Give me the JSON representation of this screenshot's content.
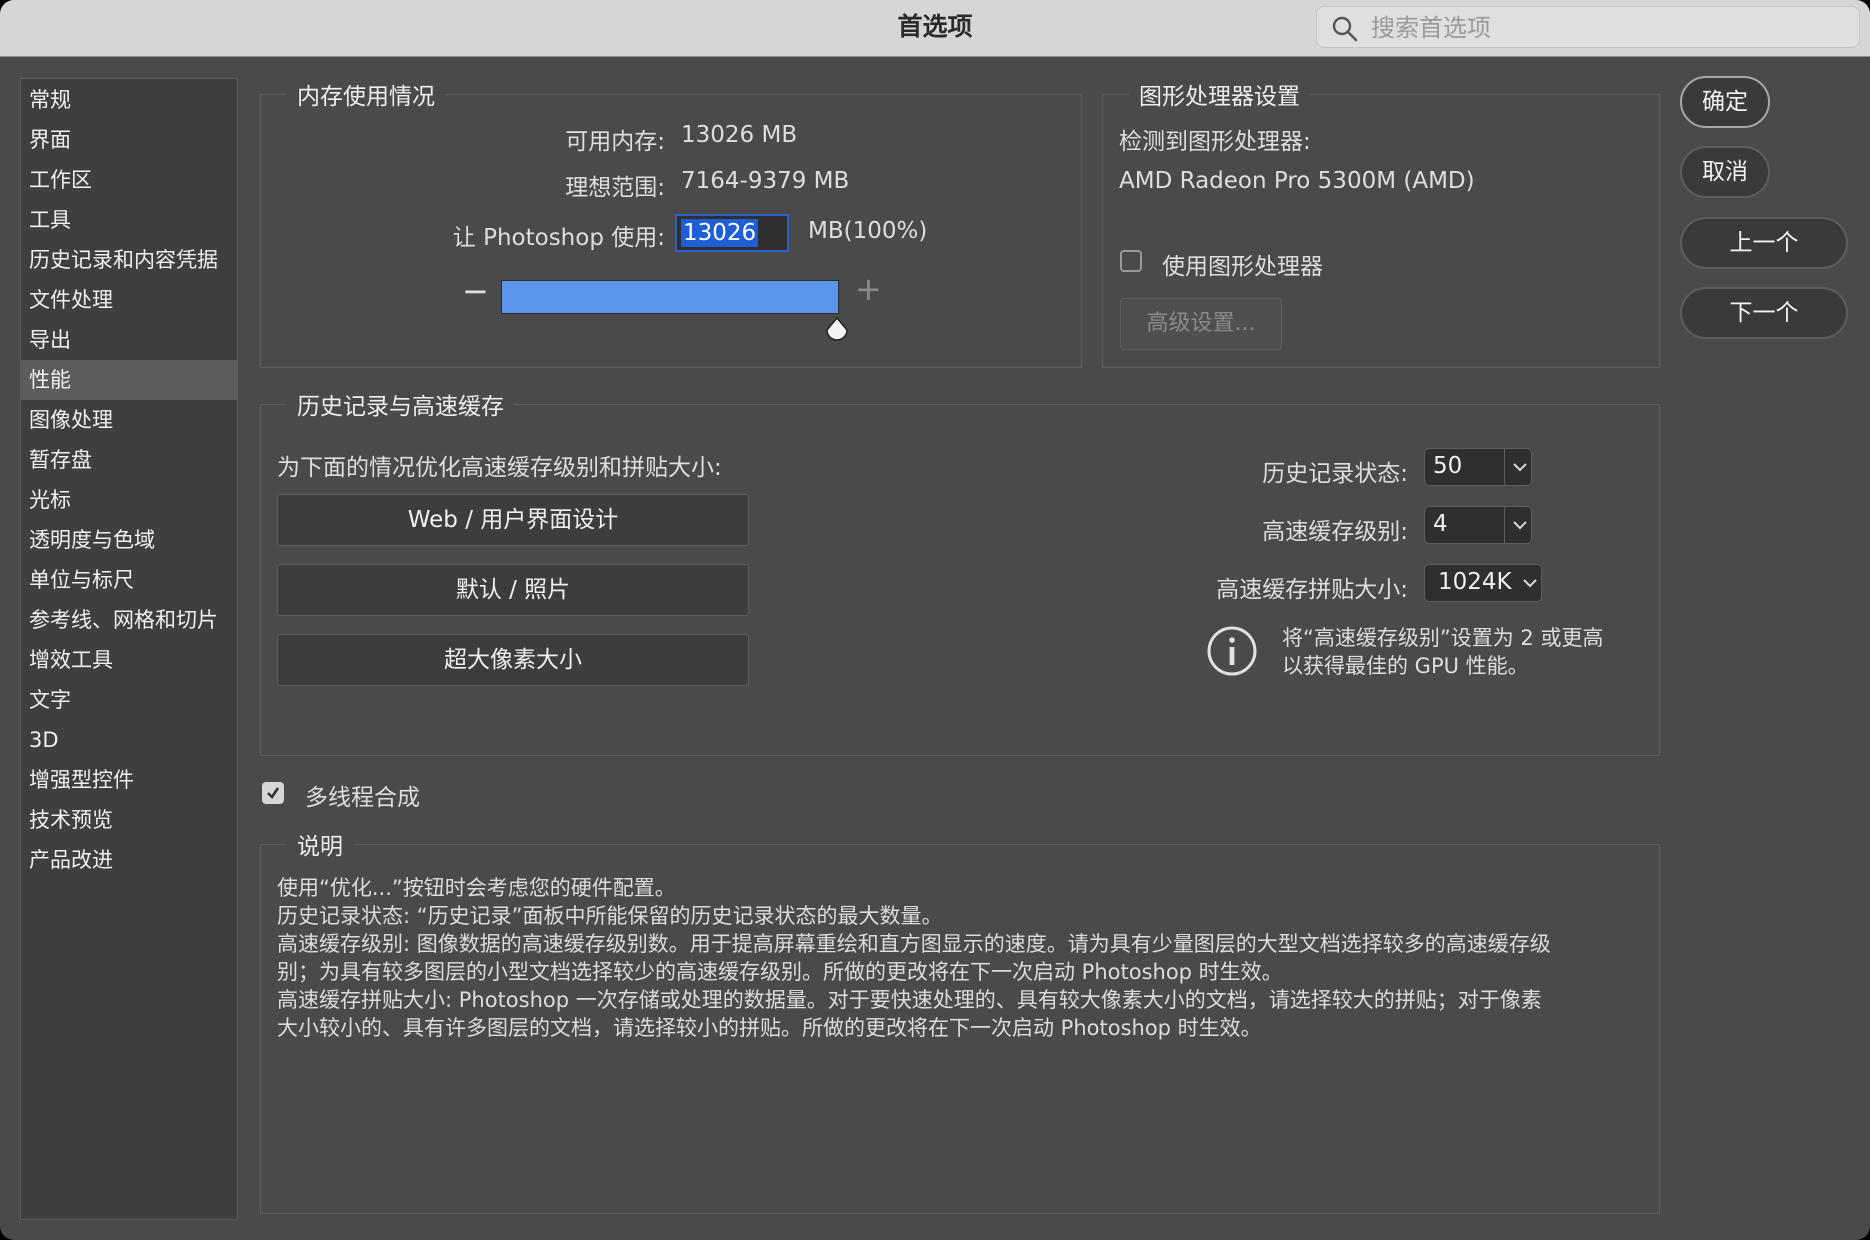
{
  "window": {
    "title": "首选项"
  },
  "search": {
    "placeholder": "搜索首选项"
  },
  "sidebar": {
    "items": [
      "常规",
      "界面",
      "工作区",
      "工具",
      "历史记录和内容凭据",
      "文件处理",
      "导出",
      "性能",
      "图像处理",
      "暂存盘",
      "光标",
      "透明度与色域",
      "单位与标尺",
      "参考线、网格和切片",
      "增效工具",
      "文字",
      "3D",
      "增强型控件",
      "技术预览",
      "产品改进"
    ],
    "active_index": 7
  },
  "memory": {
    "legend": "内存使用情况",
    "available_label": "可用内存:",
    "available_value": "13026 MB",
    "ideal_label": "理想范围:",
    "ideal_value": "7164-9379 MB",
    "use_label": "让 Photoshop 使用:",
    "use_value": "13026",
    "use_unit": "MB(100%)",
    "slider_level": 1.0,
    "minus": "−",
    "plus": "+"
  },
  "gpu": {
    "legend": "图形处理器设置",
    "detected_label": "检测到图形处理器:",
    "gpu_name": "AMD Radeon Pro 5300M (AMD)",
    "use_gpu_label": "使用图形处理器",
    "use_gpu_checked": false,
    "advanced_button": "高级设置..."
  },
  "buttons": {
    "ok": "确定",
    "cancel": "取消",
    "prev": "上一个",
    "next": "下一个"
  },
  "history": {
    "legend": "历史记录与高速缓存",
    "optimize_label": "为下面的情况优化高速缓存级别和拼贴大小:",
    "opt_buttons": [
      "Web / 用户界面设计",
      "默认 / 照片",
      "超大像素大小"
    ],
    "states_label": "历史记录状态:",
    "states_value": "50",
    "cache_levels_label": "高速缓存级别:",
    "cache_levels_value": "4",
    "tile_size_label": "高速缓存拼贴大小:",
    "tile_size_value": "1024K",
    "info_line1": "将“高速缓存级别”设置为 2 或更高",
    "info_line2": "以获得最佳的 GPU 性能。"
  },
  "multithread": {
    "label": "多线程合成",
    "checked": true
  },
  "description": {
    "legend": "说明",
    "lines": [
      "使用“优化...”按钮时会考虑您的硬件配置。",
      "历史记录状态: “历史记录”面板中所能保留的历史记录状态的最大数量。",
      "高速缓存级别: 图像数据的高速缓存级别数。用于提高屏幕重绘和直方图显示的速度。请为具有少量图层的大型文档选择较多的高速缓存级",
      "别；为具有较多图层的小型文档选择较少的高速缓存级别。所做的更改将在下一次启动 Photoshop 时生效。",
      "高速缓存拼贴大小: Photoshop 一次存储或处理的数据量。对于要快速处理的、具有较大像素大小的文档，请选择较大的拼贴；对于像素",
      "大小较小的、具有许多图层的文档，请选择较小的拼贴。所做的更改将在下一次启动 Photoshop 时生效。"
    ]
  }
}
